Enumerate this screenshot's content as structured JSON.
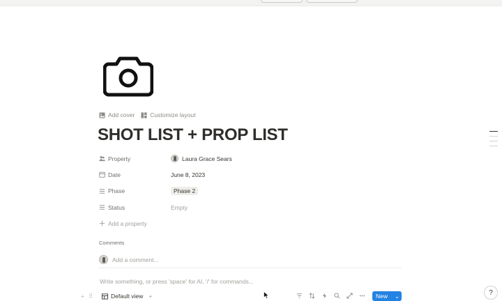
{
  "page": {
    "icon": "camera-icon",
    "title": "SHOT LIST + PROP LIST"
  },
  "cover_actions": {
    "add_cover": "Add cover",
    "customize_layout": "Customize layout"
  },
  "properties": [
    {
      "key": "Property",
      "icon": "people-icon",
      "value": "Laura Grace Sears",
      "type": "person"
    },
    {
      "key": "Date",
      "icon": "calendar-icon",
      "value": "June 8, 2023",
      "type": "date"
    },
    {
      "key": "Phase",
      "icon": "list-icon",
      "value": "Phase 2",
      "type": "tag"
    },
    {
      "key": "Status",
      "icon": "list-icon",
      "value": "Empty",
      "type": "empty"
    }
  ],
  "add_property": "Add a property",
  "comments": {
    "label": "Comments",
    "placeholder": "Add a comment..."
  },
  "editor": {
    "hint": "Write something, or press 'space' for AI, '/' for commands..."
  },
  "database": {
    "view_label": "Default view",
    "add_view": "+",
    "new_label": "New"
  },
  "help": {
    "label": "?"
  },
  "colors": {
    "accent": "#2383e2",
    "text": "#37352f",
    "muted": "#a19f9a"
  }
}
